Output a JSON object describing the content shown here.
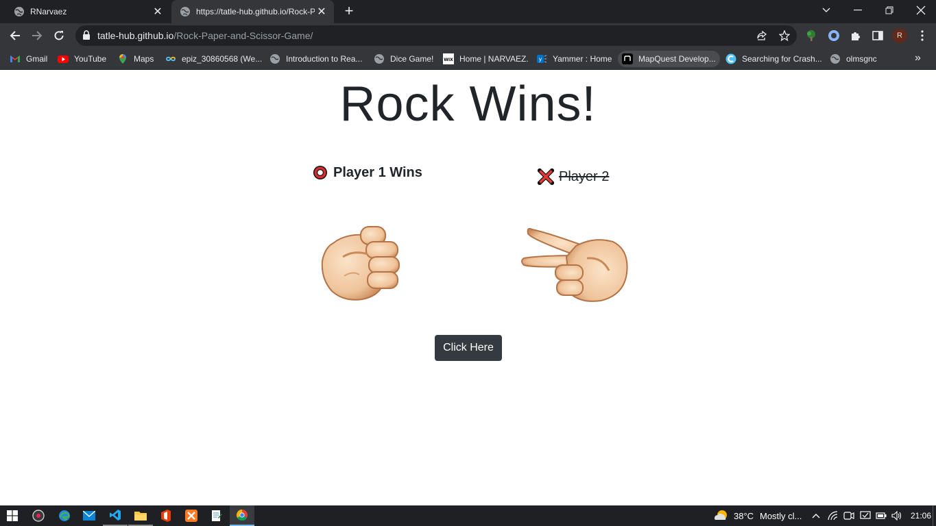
{
  "browser": {
    "tabs": [
      {
        "title": "RNarvaez",
        "active": false
      },
      {
        "title": "https://tatle-hub.github.io/Rock-Paper-and-Scissor-Game/",
        "active": true
      }
    ],
    "address": {
      "host": "tatle-hub.github.io",
      "path": "/Rock-Paper-and-Scissor-Game/"
    },
    "profile_initial": "R",
    "bookmarks": [
      {
        "label": "Gmail",
        "icon": "gmail-icon"
      },
      {
        "label": "YouTube",
        "icon": "youtube-icon"
      },
      {
        "label": "Maps",
        "icon": "maps-icon"
      },
      {
        "label": "epiz_30860568 (We...",
        "icon": "infinity-icon"
      },
      {
        "label": "Introduction to Rea...",
        "icon": "globe-icon"
      },
      {
        "label": "Dice Game!",
        "icon": "globe-icon"
      },
      {
        "label": "Home | NARVAEZ.",
        "icon": "wix-icon"
      },
      {
        "label": "Yammer : Home",
        "icon": "yammer-icon"
      },
      {
        "label": "MapQuest Develop...",
        "icon": "mapquest-icon"
      },
      {
        "label": "Searching for Crash...",
        "icon": "crash-icon"
      },
      {
        "label": "olmsgnc",
        "icon": "globe-icon"
      }
    ]
  },
  "page": {
    "heading": "Rock Wins!",
    "player1": {
      "label": "Player 1 Wins",
      "status": "winner",
      "hand": "rock"
    },
    "player2": {
      "label": "Player 2",
      "status": "loser",
      "hand": "scissors"
    },
    "button_label": "Click Here"
  },
  "taskbar": {
    "weather_temp": "38°C",
    "weather_desc": "Mostly cl...",
    "time": "21:06"
  },
  "colors": {
    "page_text": "#212529",
    "button_bg": "#343a40",
    "winner_mark": "#d32f2f",
    "loser_mark": "#d32f2f",
    "tab_strip": "#202124",
    "toolbar": "#35363a"
  }
}
